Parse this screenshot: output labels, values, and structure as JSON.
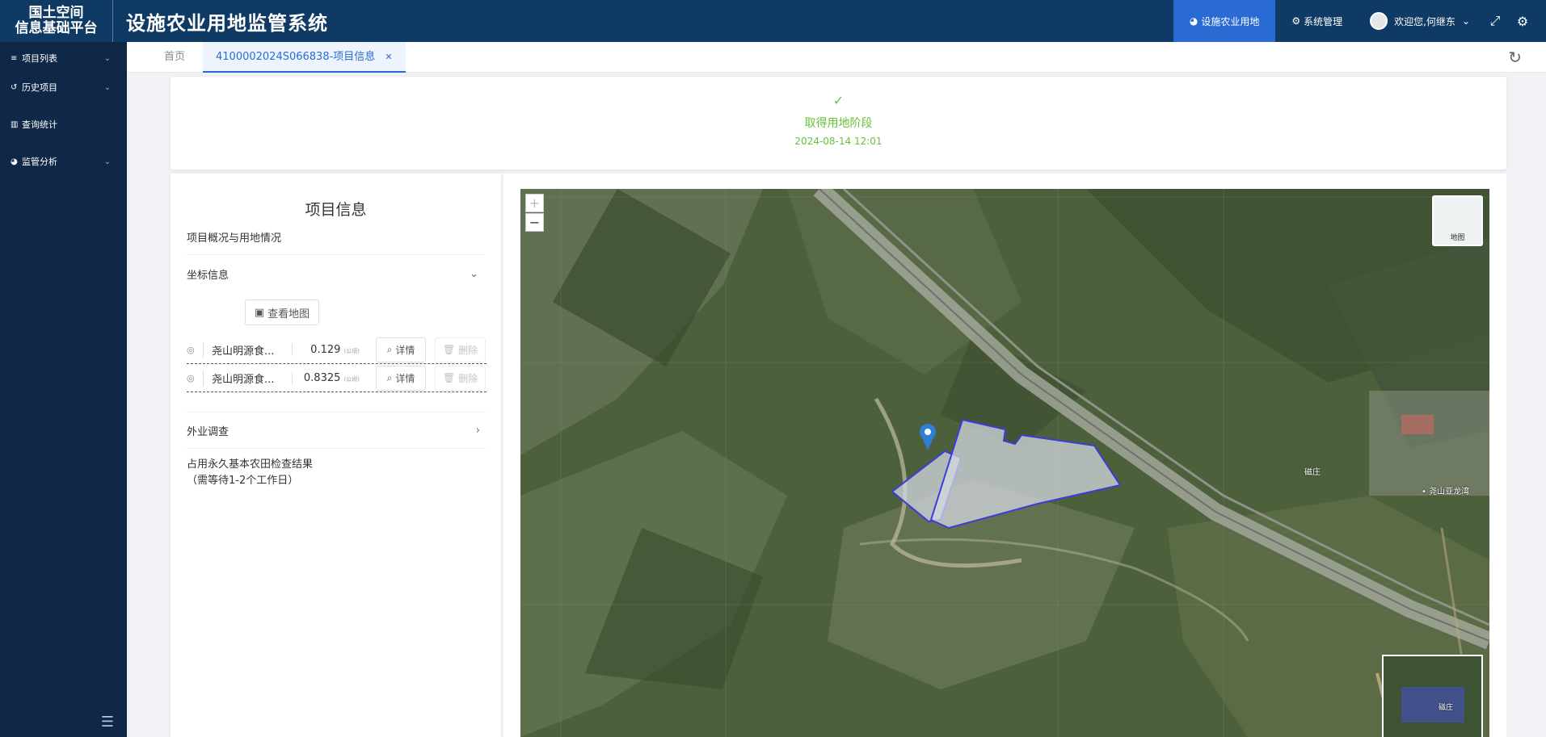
{
  "header": {
    "logo_line1": "国土空间",
    "logo_line2": "信息基础平台",
    "title": "设施农业用地监管系统",
    "nav_active": "设施农业用地",
    "nav_system": "系统管理",
    "user_greeting": "欢迎您,何继东"
  },
  "sidebar": {
    "items": [
      {
        "label": "项目列表"
      },
      {
        "label": "历史项目"
      },
      {
        "label": "查询统计"
      },
      {
        "label": "监管分析"
      }
    ]
  },
  "tabs": {
    "home": "首页",
    "active": "4100002024S066838-项目信息"
  },
  "status": {
    "label": "取得用地阶段",
    "time": "2024-08-14 12:01"
  },
  "left_panel": {
    "title": "项目信息",
    "overview": "项目概况与用地情况",
    "coord_section": "坐标信息",
    "view_map_button": "查看地图",
    "coord_rows": [
      {
        "name": "尧山明源食...",
        "area": "0.129",
        "unit": "(公顷)",
        "detail": "详情",
        "delete": "删除"
      },
      {
        "name": "尧山明源食...",
        "area": "0.8325",
        "unit": "(公顷)",
        "detail": "详情",
        "delete": "删除"
      }
    ],
    "field_survey": "外业调查",
    "check_result_line1": "占用永久基本农田检查结果",
    "check_result_line2": "（需等待1-2个工作日）"
  },
  "map": {
    "zoom_in": "+",
    "zoom_out": "−",
    "layer_switch_label": "地图",
    "place_label_1": "磁庄",
    "place_label_2": "• 尧山亚龙湾",
    "overview_label": "磁庄"
  }
}
